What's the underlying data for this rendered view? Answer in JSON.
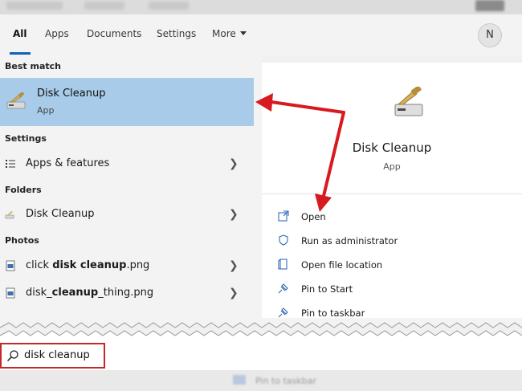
{
  "tabs": [
    {
      "label": "All",
      "active": true
    },
    {
      "label": "Apps"
    },
    {
      "label": "Documents"
    },
    {
      "label": "Settings"
    },
    {
      "label": "More"
    }
  ],
  "user": {
    "initial": "N"
  },
  "sections": {
    "best_match": "Best match",
    "settings": "Settings",
    "folders": "Folders",
    "photos": "Photos"
  },
  "best_match": {
    "title": "Disk Cleanup",
    "subtitle": "App"
  },
  "results": {
    "settings_item": "Apps & features",
    "folder_item": "Disk Cleanup",
    "photo1_prefix": "click ",
    "photo1_bold": "disk cleanup",
    "photo1_suffix": ".png",
    "photo2_prefix": "disk_",
    "photo2_bold": "cleanup",
    "photo2_suffix": "_thing.png"
  },
  "details": {
    "title": "Disk Cleanup",
    "subtitle": "App",
    "actions": [
      {
        "label": "Open",
        "icon": "open-icon"
      },
      {
        "label": "Run as administrator",
        "icon": "shield-icon"
      },
      {
        "label": "Open file location",
        "icon": "file-location-icon"
      },
      {
        "label": "Pin to Start",
        "icon": "pin-icon"
      },
      {
        "label": "Pin to taskbar",
        "icon": "pin-icon"
      }
    ]
  },
  "search": {
    "query": "disk cleanup"
  },
  "colors": {
    "accent": "#0f63b8",
    "highlight": "#a8cbe9",
    "annotation": "#d71920"
  }
}
